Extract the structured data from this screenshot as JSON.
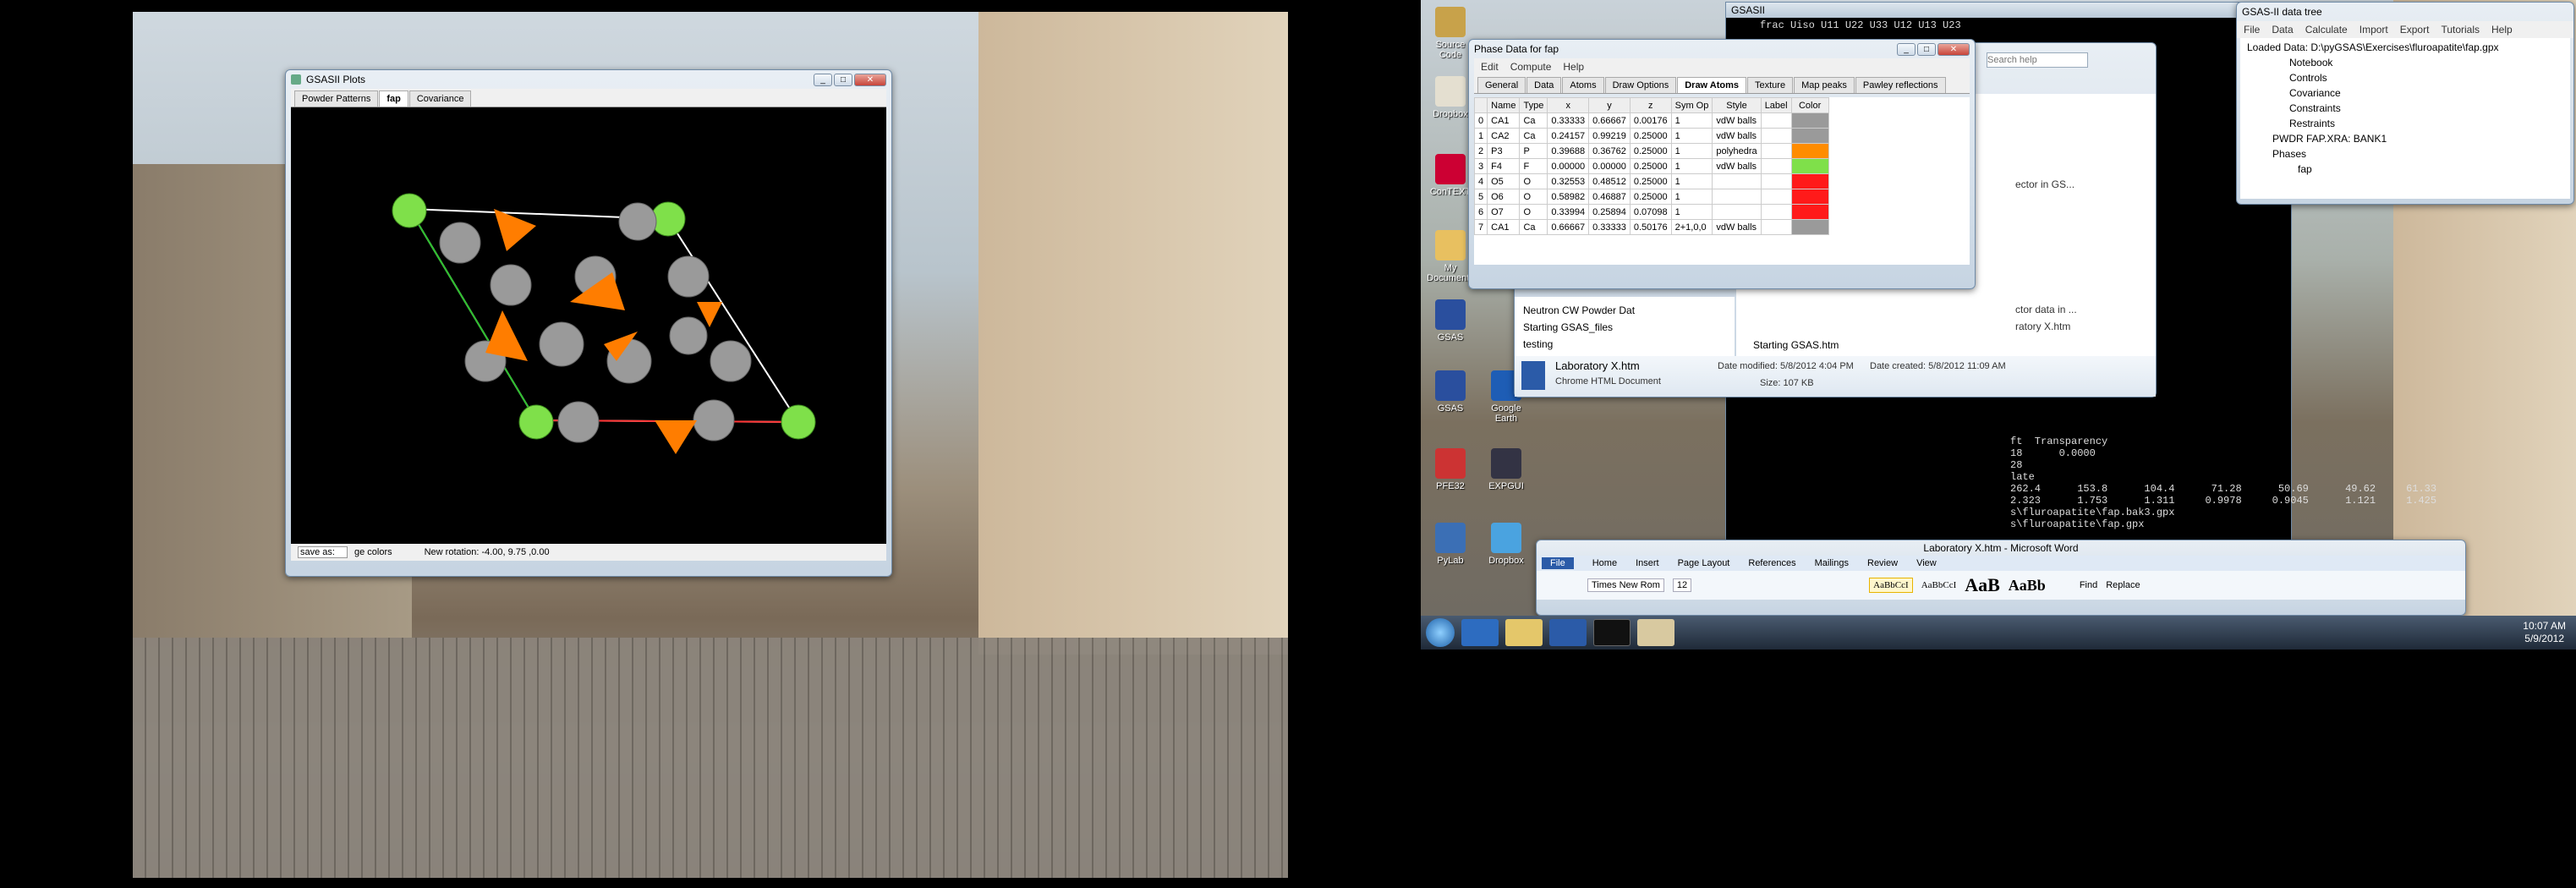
{
  "plots_window": {
    "title": "GSASII Plots",
    "tabs": [
      "Powder Patterns",
      "fap",
      "Covariance"
    ],
    "active_tab": "fap",
    "save_label": "save as:",
    "colors_label": "ge colors",
    "status": "New rotation: -4.00, 9.75 ,0.00"
  },
  "phase_window": {
    "title": "Phase Data for fap",
    "menu": [
      "Edit",
      "Compute",
      "Help"
    ],
    "tabs": [
      "General",
      "Data",
      "Atoms",
      "Draw Options",
      "Draw Atoms",
      "Texture",
      "Map peaks",
      "Pawley reflections"
    ],
    "active_tab": "Draw Atoms",
    "columns": [
      "",
      "Name",
      "Type",
      "x",
      "y",
      "z",
      "Sym Op",
      "Style",
      "Label",
      "Color"
    ],
    "rows": [
      [
        "0",
        "CA1",
        "Ca",
        "0.33333",
        "0.66667",
        "0.00176",
        "1",
        "vdW balls",
        "",
        "#9a9a9a"
      ],
      [
        "1",
        "CA2",
        "Ca",
        "0.24157",
        "0.99219",
        "0.25000",
        "1",
        "vdW balls",
        "",
        "#9a9a9a"
      ],
      [
        "2",
        "P3",
        "P",
        "0.39688",
        "0.36762",
        "0.25000",
        "1",
        "polyhedra",
        "",
        "#ff8c00"
      ],
      [
        "3",
        "F4",
        "F",
        "0.00000",
        "0.00000",
        "0.25000",
        "1",
        "vdW balls",
        "",
        "#7fe04a"
      ],
      [
        "4",
        "O5",
        "O",
        "0.32553",
        "0.48512",
        "0.25000",
        "1",
        "",
        "",
        "#ff1a1a"
      ],
      [
        "5",
        "O6",
        "O",
        "0.58982",
        "0.46887",
        "0.25000",
        "1",
        "",
        "",
        "#ff1a1a"
      ],
      [
        "6",
        "O7",
        "O",
        "0.33994",
        "0.25894",
        "0.07098",
        "1",
        "",
        "",
        "#ff1a1a"
      ],
      [
        "7",
        "CA1",
        "Ca",
        "0.66667",
        "0.33333",
        "0.50176",
        "2+1,0,0",
        "vdW balls",
        "",
        "#9a9a9a"
      ]
    ]
  },
  "tree_window": {
    "title": "GSAS-II data tree",
    "menu": [
      "File",
      "Data",
      "Calculate",
      "Import",
      "Export",
      "Tutorials",
      "Help"
    ],
    "items": [
      "Loaded Data: D:\\pyGSAS\\Exercises\\fluroapatite\\fap.gpx",
      "Notebook",
      "Controls",
      "Covariance",
      "Constraints",
      "Restraints",
      "PWDR FAP.XRA: BANK1",
      "Phases",
      "fap"
    ]
  },
  "console_window": {
    "title": "GSASII",
    "header": "frac  Uiso    U11    U22    U33    U12    U13    U23",
    "lines": [
      "ft  Transparency",
      "18      0.0000",
      "28",
      "",
      "late",
      "262.4      153.8      104.4      71.28      50.69      49.62     61.33",
      "2.323      1.753      1.311     0.9978     0.9045      1.121     1.425",
      "",
      "s\\fluroapatite\\fap.bak3.gpx",
      "s\\fluroapatite\\fap.gpx"
    ]
  },
  "explorer": {
    "files": [
      "Neutron CW Powder Dat",
      "Starting GSAS_files",
      "testing",
      "testing"
    ],
    "right_files": [
      "Starting GSAS.htm"
    ],
    "peek_text": [
      "ector in GS...",
      "ctor data in ...",
      "ratory X.htm"
    ],
    "search_placeholder": "Search help",
    "selected": {
      "name": "Laboratory X.htm",
      "type": "Chrome HTML Document",
      "modified_label": "Date modified: 5/8/2012 4:04 PM",
      "created_label": "Date created: 5/8/2012 11:09 AM",
      "size": "Size: 107 KB"
    }
  },
  "word": {
    "title": "Laboratory X.htm - Microsoft Word",
    "file_tab": "File",
    "tabs": [
      "Home",
      "Insert",
      "Page Layout",
      "References",
      "Mailings",
      "Review",
      "View"
    ],
    "font": "Times New Rom",
    "size": "12",
    "styles": [
      "AaBbCcI",
      "AaBbCcI",
      "AaB",
      "AaBb"
    ],
    "find": "Find",
    "replace": "Replace"
  },
  "desktop_icons": [
    "Source Code",
    "",
    "Dropbox",
    "ConTEXT",
    "My Documents",
    "GSAS",
    "GSAS",
    "Google Earth",
    "PFE32",
    "EXPGUI",
    "PyLab",
    "Dropbox"
  ],
  "taskbar": {
    "time": "10:07 AM",
    "date": "5/9/2012"
  }
}
